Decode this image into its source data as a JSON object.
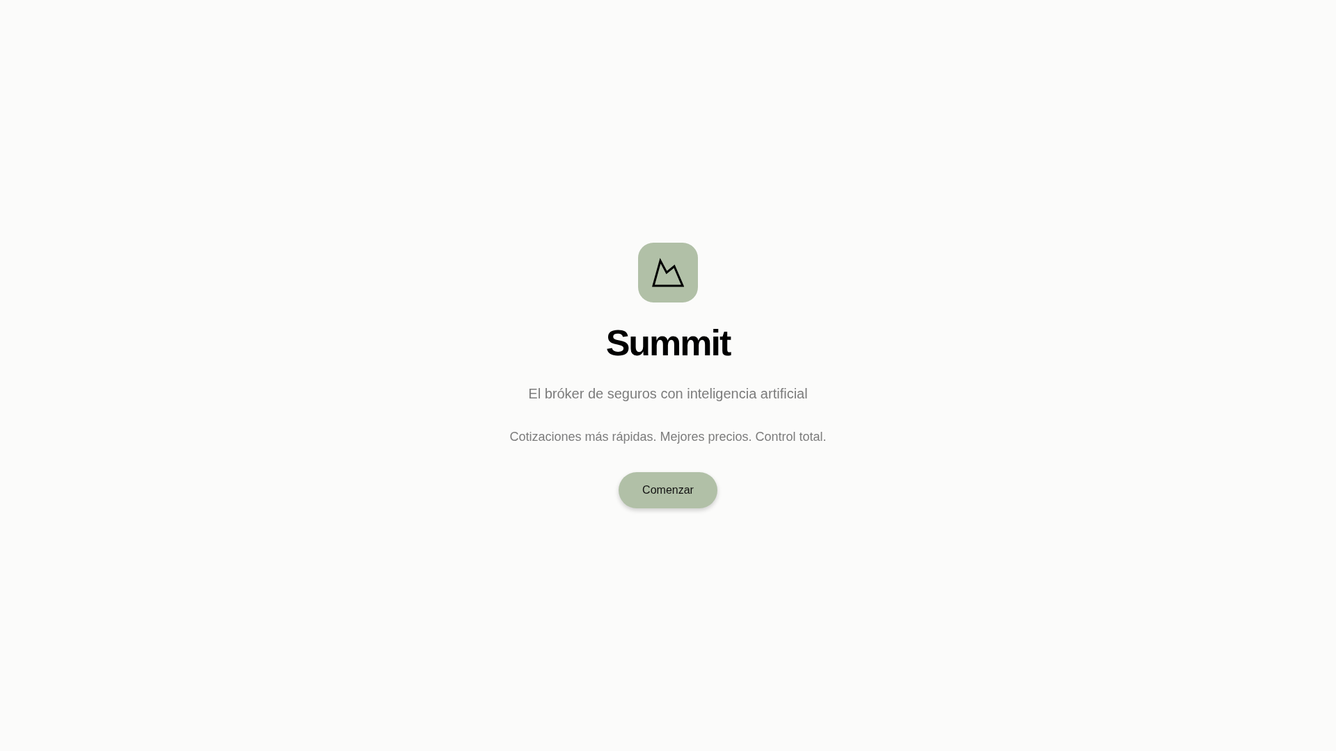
{
  "brand": {
    "title": "Summit",
    "tagline": "El bróker de seguros con inteligencia artificial",
    "description": "Cotizaciones más rápidas. Mejores precios. Control total."
  },
  "actions": [
    {
      "kind": "primary",
      "label": "Comenzar"
    }
  ]
}
